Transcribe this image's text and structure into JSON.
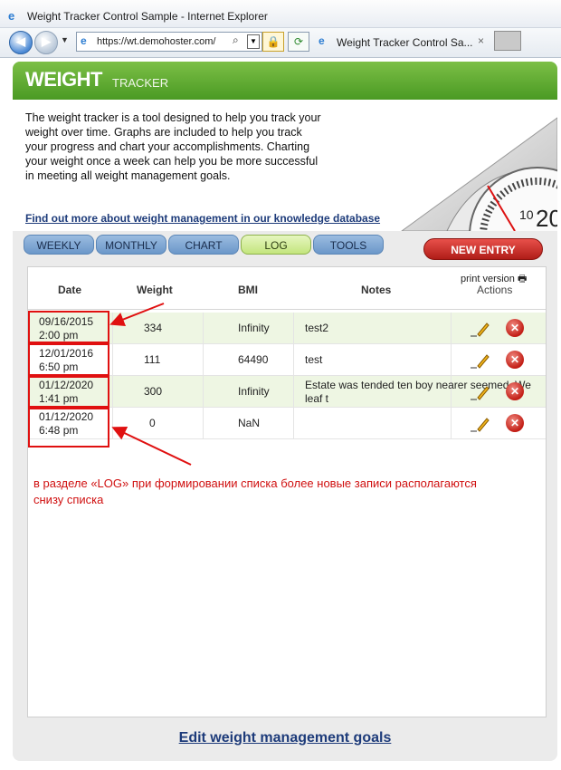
{
  "browser": {
    "window_title": "Weight Tracker Control Sample - Internet Explorer",
    "url": "https://wt.demohoster.com/",
    "tab_title": "Weight Tracker Control Sa...",
    "tab_close": "×"
  },
  "app": {
    "logo_main": "WEIGHT",
    "logo_sub": "TRACKER",
    "intro_text": "The weight tracker is a tool designed to help you track your weight over time. Graphs are included to help you track your progress and chart your accomplishments. Charting your weight once a week can help you be more successful in meeting all weight management goals.",
    "kb_link": "Find out more about weight management in our knowledge database",
    "tabs": [
      {
        "label": "WEEKLY",
        "active": false
      },
      {
        "label": "MONTHLY",
        "active": false
      },
      {
        "label": "CHART",
        "active": false
      },
      {
        "label": "LOG",
        "active": true
      },
      {
        "label": "TOOLS",
        "active": false
      }
    ],
    "new_entry": "NEW ENTRY",
    "print_version": "print version",
    "columns": [
      "Date",
      "Weight",
      "BMI",
      "Notes",
      "Actions"
    ],
    "rows": [
      {
        "date": "09/16/2015",
        "time": "2:00 pm",
        "weight": "334",
        "bmi": "Infinity",
        "notes": "test2",
        "notes2": ""
      },
      {
        "date": "12/01/2016",
        "time": "6:50 pm",
        "weight": "111",
        "bmi": "64490",
        "notes": "test",
        "notes2": ""
      },
      {
        "date": "01/12/2020",
        "time": "1:41 pm",
        "weight": "300",
        "bmi": "Infinity",
        "notes": "Estate was tended ten boy nearer seemed. We",
        "notes2": "leaf t"
      },
      {
        "date": "01/12/2020",
        "time": "6:48 pm",
        "weight": "0",
        "bmi": "NaN",
        "notes": "",
        "notes2": ""
      }
    ],
    "annotation": "в разделе «LOG» при формировании списка более новые записи располагаются снизу списка",
    "goals_link": "Edit weight management goals",
    "scale_numbers": [
      "10",
      "20"
    ]
  },
  "colors": {
    "header_green": "#4a9a23",
    "tab_blue": "#6b97c9",
    "tab_active": "#c3e57d",
    "new_entry_red": "#b01d18",
    "annotation_red": "#e01010",
    "row_alt": "#eef6e3",
    "link_blue": "#1d3b7a"
  },
  "icons": {
    "back": "back-arrow-icon",
    "forward": "forward-arrow-icon",
    "ie": "ie-logo-icon",
    "search": "search-icon",
    "lock": "lock-icon",
    "refresh": "refresh-icon",
    "edit": "pencil-icon",
    "delete": "delete-icon",
    "printer": "printer-icon"
  }
}
